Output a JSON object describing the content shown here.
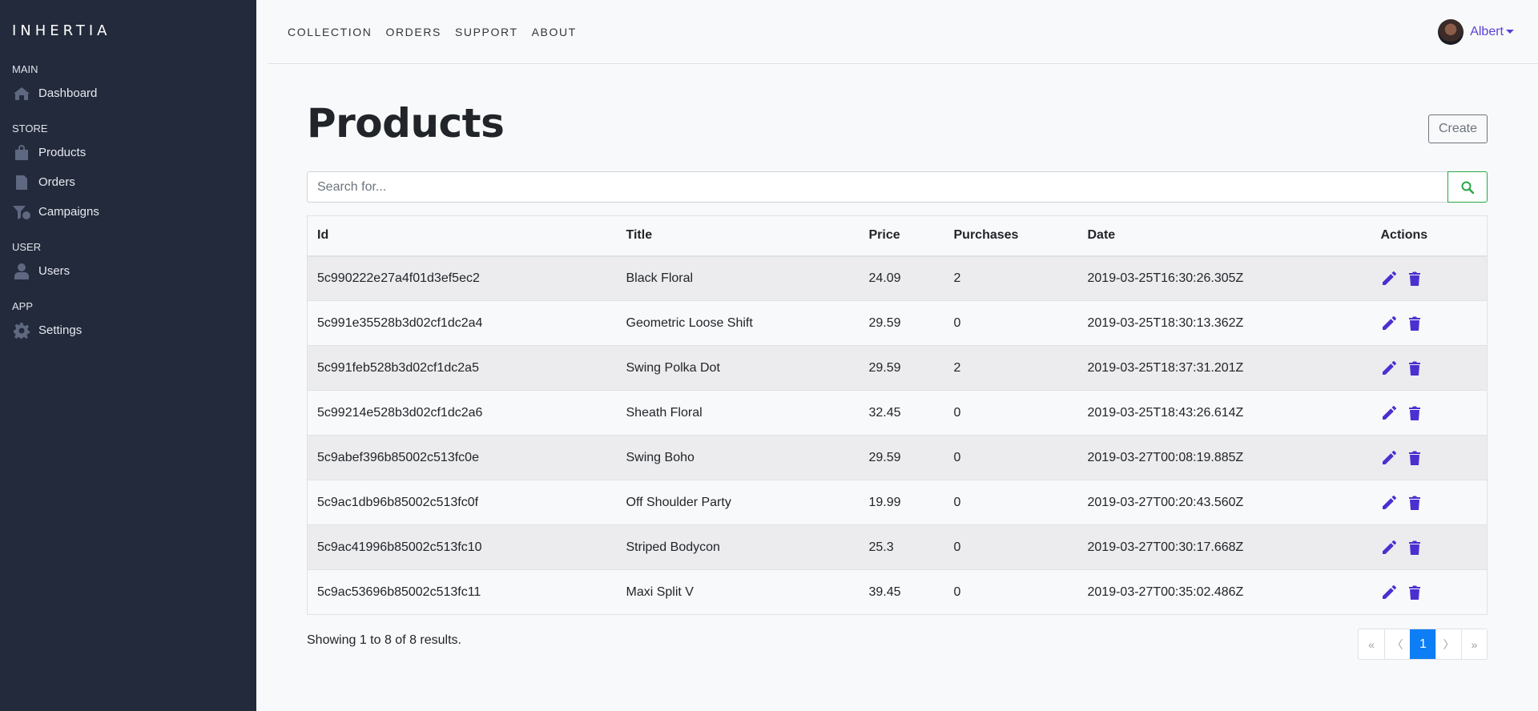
{
  "brand": "INHERTIA",
  "sidebar": {
    "sections": [
      {
        "heading": "MAIN",
        "items": [
          {
            "label": "Dashboard",
            "icon": "home-icon"
          }
        ]
      },
      {
        "heading": "STORE",
        "items": [
          {
            "label": "Products",
            "icon": "shopping-bag-icon"
          },
          {
            "label": "Orders",
            "icon": "receipt-icon"
          },
          {
            "label": "Campaigns",
            "icon": "funnel-dollar-icon"
          }
        ]
      },
      {
        "heading": "USER",
        "items": [
          {
            "label": "Users",
            "icon": "user-icon"
          }
        ]
      },
      {
        "heading": "APP",
        "items": [
          {
            "label": "Settings",
            "icon": "gear-icon"
          }
        ]
      }
    ]
  },
  "topnav": {
    "links": [
      "COLLECTION",
      "ORDERS",
      "SUPPORT",
      "ABOUT"
    ]
  },
  "user": {
    "name": "Albert"
  },
  "page": {
    "title": "Products",
    "create_label": "Create"
  },
  "search": {
    "placeholder": "Search for..."
  },
  "table": {
    "headers": [
      "Id",
      "Title",
      "Price",
      "Purchases",
      "Date",
      "Actions"
    ],
    "rows": [
      [
        "5c990222e27a4f01d3ef5ec2",
        "Black Floral",
        "24.09",
        "2",
        "2019-03-25T16:30:26.305Z"
      ],
      [
        "5c991e35528b3d02cf1dc2a4",
        "Geometric Loose Shift",
        "29.59",
        "0",
        "2019-03-25T18:30:13.362Z"
      ],
      [
        "5c991feb528b3d02cf1dc2a5",
        "Swing Polka Dot",
        "29.59",
        "2",
        "2019-03-25T18:37:31.201Z"
      ],
      [
        "5c99214e528b3d02cf1dc2a6",
        "Sheath Floral",
        "32.45",
        "0",
        "2019-03-25T18:43:26.614Z"
      ],
      [
        "5c9abef396b85002c513fc0e",
        "Swing Boho",
        "29.59",
        "0",
        "2019-03-27T00:08:19.885Z"
      ],
      [
        "5c9ac1db96b85002c513fc0f",
        "Off Shoulder Party",
        "19.99",
        "0",
        "2019-03-27T00:20:43.560Z"
      ],
      [
        "5c9ac41996b85002c513fc10",
        "Striped Bodycon",
        "25.3",
        "0",
        "2019-03-27T00:30:17.668Z"
      ],
      [
        "5c9ac53696b85002c513fc11",
        "Maxi Split V",
        "39.45",
        "0",
        "2019-03-27T00:35:02.486Z"
      ]
    ]
  },
  "footer": {
    "results_text": "Showing 1 to 8 of 8 results."
  },
  "pagination": {
    "first": "«",
    "prev": "〈",
    "current": "1",
    "next": "〉",
    "last": "»"
  },
  "colors": {
    "sidebar_bg": "#232a3b",
    "accent": "#5a3fd8",
    "search_button": "#28a745",
    "page_active": "#0d7ef5"
  }
}
